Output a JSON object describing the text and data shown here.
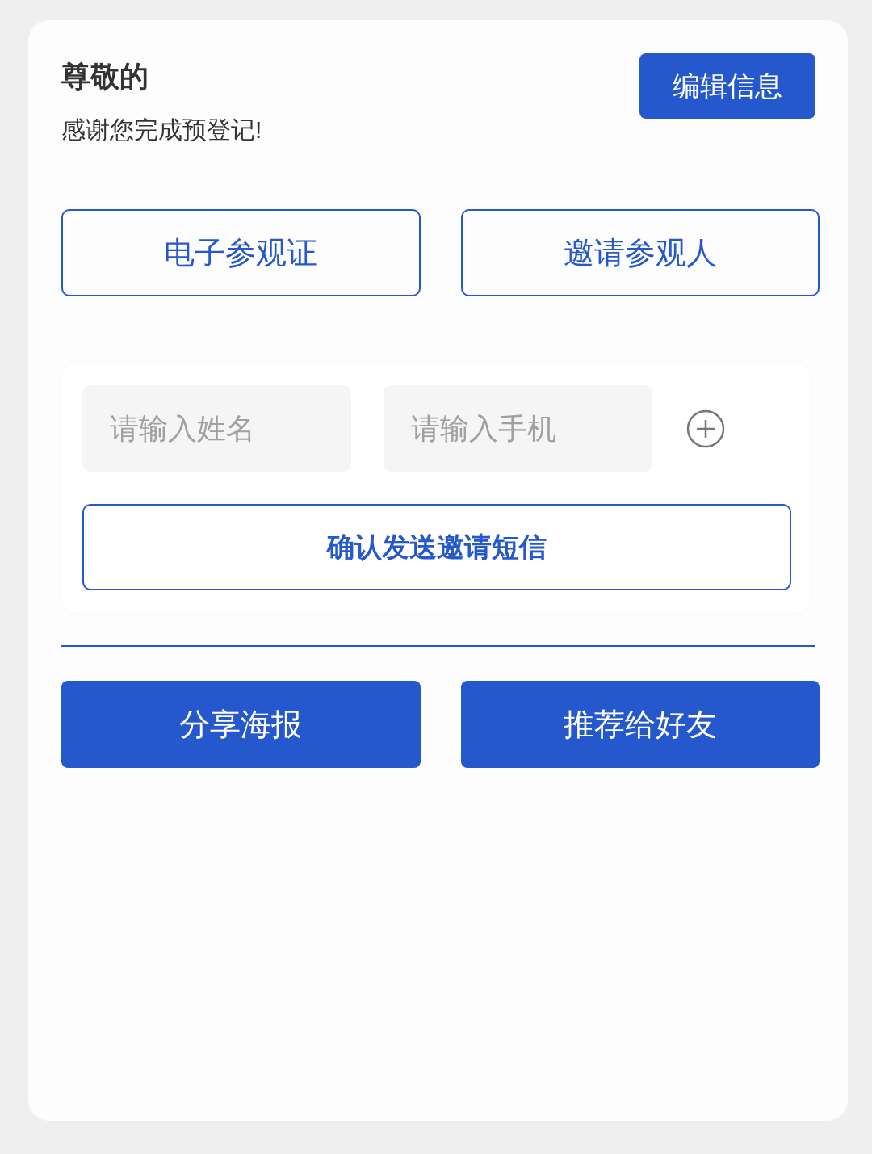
{
  "greeting": "尊敬的",
  "edit_button": "编辑信息",
  "thanks": "感谢您完成预登记!",
  "tabs": [
    {
      "label": "电子参观证"
    },
    {
      "label": "邀请参观人"
    }
  ],
  "invite": {
    "name_field": {
      "placeholder": "请输入姓名"
    },
    "phone_field": {
      "placeholder": "请输入手机"
    },
    "confirm_button": "确认发送邀请短信"
  },
  "actions": [
    "分享海报",
    "推荐给好友"
  ]
}
